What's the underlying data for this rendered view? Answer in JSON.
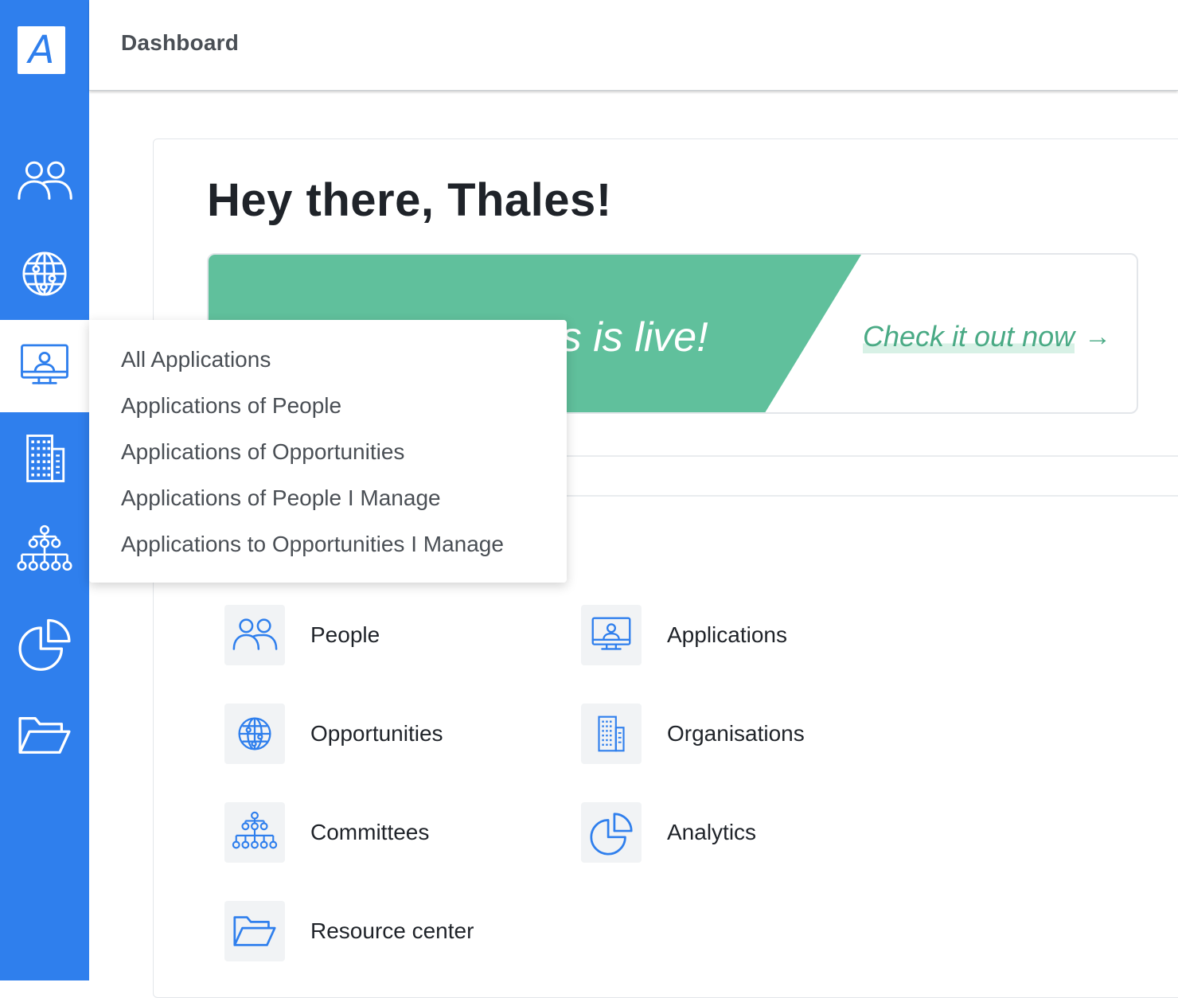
{
  "app": {
    "logo_letter": "A",
    "page_title": "Dashboard"
  },
  "colors": {
    "sidebar": "#2f7fed",
    "banner_green": "#60c09c",
    "cta_green": "#4aaa85"
  },
  "sidebar": {
    "items": [
      {
        "name": "people",
        "icon": "people-icon",
        "active": false
      },
      {
        "name": "opportunities",
        "icon": "globe-icon",
        "active": false
      },
      {
        "name": "applications",
        "icon": "monitor-user-icon",
        "active": true
      },
      {
        "name": "organisations",
        "icon": "building-icon",
        "active": false
      },
      {
        "name": "committees",
        "icon": "org-chart-icon",
        "active": false
      },
      {
        "name": "analytics",
        "icon": "pie-chart-icon",
        "active": false
      },
      {
        "name": "resource-center",
        "icon": "folder-open-icon",
        "active": false
      }
    ]
  },
  "greeting": "Hey there, Thales!",
  "banner": {
    "headline": "Team Analytics is live!",
    "cta": "Check it out now",
    "cta_arrow": "→"
  },
  "dropdown": {
    "items": [
      "All Applications",
      "Applications of People",
      "Applications of Opportunities",
      "Applications of People I Manage",
      "Applications to Opportunities I Manage"
    ]
  },
  "shortcuts": [
    {
      "label": "People",
      "icon": "people-icon"
    },
    {
      "label": "Applications",
      "icon": "monitor-user-icon"
    },
    {
      "label": "Opportunities",
      "icon": "globe-icon"
    },
    {
      "label": "Organisations",
      "icon": "building-icon"
    },
    {
      "label": "Committees",
      "icon": "org-chart-icon"
    },
    {
      "label": "Analytics",
      "icon": "pie-chart-icon"
    },
    {
      "label": "Resource center",
      "icon": "folder-open-icon"
    }
  ]
}
